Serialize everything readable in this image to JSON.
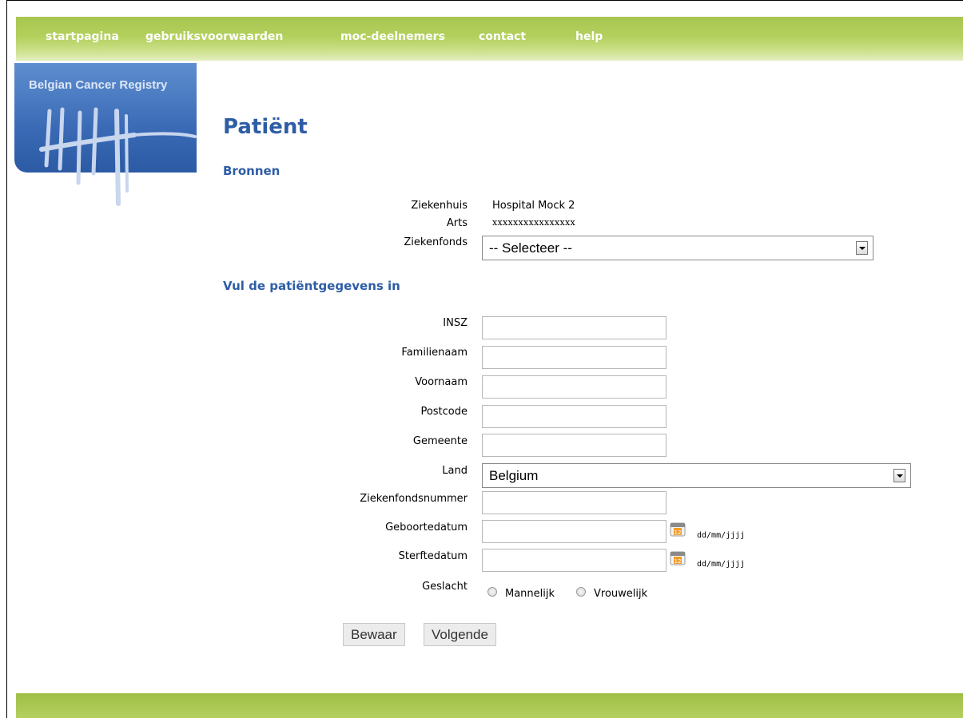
{
  "nav": {
    "items": [
      "startpagina",
      "gebruiksvoorwaarden",
      "moc-deelnemers",
      "contact",
      "help"
    ]
  },
  "logo": {
    "text": "Belgian Cancer Registry"
  },
  "page": {
    "title": "Patiënt",
    "sources_heading": "Bronnen",
    "patient_heading": "Vul de patiëntgegevens in"
  },
  "sources": {
    "hospital_label": "Ziekenhuis",
    "hospital_value": "Hospital Mock 2",
    "doctor_label": "Arts",
    "doctor_value": "xxxxxxxxxxxxxxxx",
    "fund_label": "Ziekenfonds",
    "fund_selected": "-- Selecteer --"
  },
  "form": {
    "insz_label": "INSZ",
    "insz_value": "",
    "lastname_label": "Familienaam",
    "lastname_value": "",
    "firstname_label": "Voornaam",
    "firstname_value": "",
    "postcode_label": "Postcode",
    "postcode_value": "",
    "city_label": "Gemeente",
    "city_value": "",
    "country_label": "Land",
    "country_selected": "Belgium",
    "fundnumber_label": "Ziekenfondsnummer",
    "fundnumber_value": "",
    "birthdate_label": "Geboortedatum",
    "birthdate_value": "",
    "birthdate_format": "dd/mm/jjjj",
    "deathdate_label": "Sterftedatum",
    "deathdate_value": "",
    "deathdate_format": "dd/mm/jjjj",
    "gender_label": "Geslacht",
    "gender_male": "Mannelijk",
    "gender_female": "Vrouwelijk"
  },
  "buttons": {
    "save": "Bewaar",
    "next": "Volgende"
  },
  "icons": {
    "calendar": "calendar-icon"
  },
  "colors": {
    "nav_green": "#a7c64f",
    "heading_blue": "#2e5da6",
    "logo_blue": "#3a6ab5"
  }
}
